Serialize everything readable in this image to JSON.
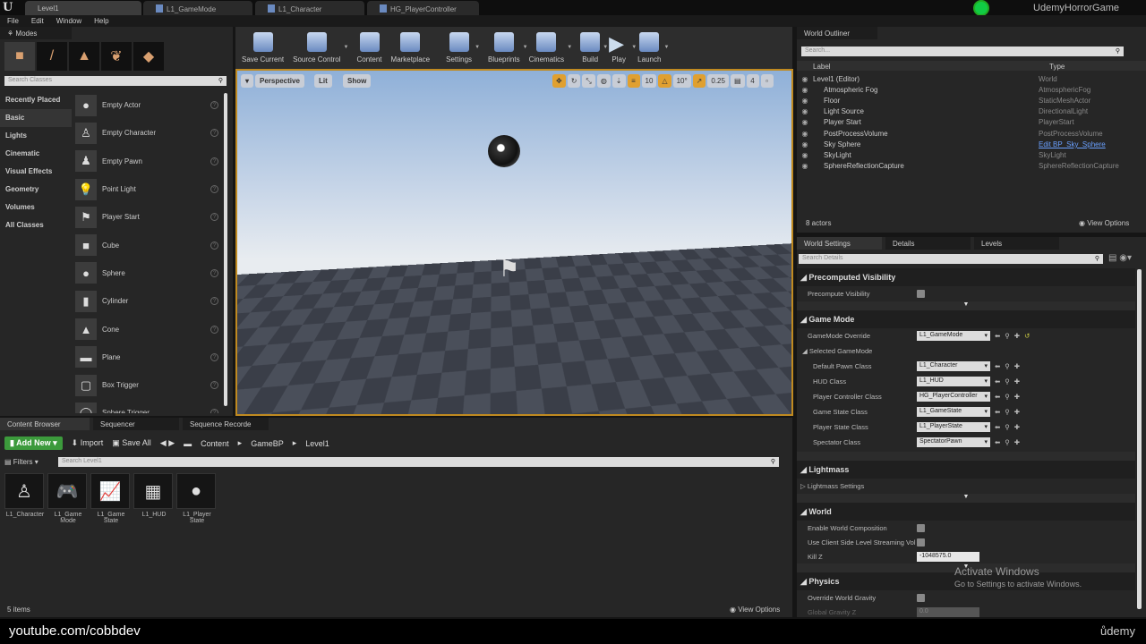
{
  "titlebar": {
    "tabs": [
      "Level1",
      "L1_GameMode",
      "L1_Character",
      "HG_PlayerController"
    ],
    "project": "UdemyHorrorGame"
  },
  "menu": [
    "File",
    "Edit",
    "Window",
    "Help"
  ],
  "modes": {
    "tab": "Modes",
    "search_placeholder": "Search Classes",
    "categories": [
      "Recently Placed",
      "Basic",
      "Lights",
      "Cinematic",
      "Visual Effects",
      "Geometry",
      "Volumes",
      "All Classes"
    ],
    "selected": 1,
    "items": [
      "Empty Actor",
      "Empty Character",
      "Empty Pawn",
      "Point Light",
      "Player Start",
      "Cube",
      "Sphere",
      "Cylinder",
      "Cone",
      "Plane",
      "Box Trigger",
      "Sphere Trigger"
    ]
  },
  "toolbar": [
    "Save Current",
    "Source Control",
    "Content",
    "Marketplace",
    "Settings",
    "Blueprints",
    "Cinematics",
    "Build",
    "Play",
    "Launch"
  ],
  "viewport": {
    "perspective": "Perspective",
    "lit": "Lit",
    "show": "Show",
    "grid": "10",
    "rotation": "10°",
    "scale": "0.25",
    "speed": "4"
  },
  "outliner": {
    "tab": "World Outliner",
    "search_placeholder": "Search...",
    "col_label": "Label",
    "col_type": "Type",
    "rows": [
      [
        "Level1 (Editor)",
        "World"
      ],
      [
        "Atmospheric Fog",
        "AtmosphericFog"
      ],
      [
        "Floor",
        "StaticMeshActor"
      ],
      [
        "Light Source",
        "DirectionalLight"
      ],
      [
        "Player Start",
        "PlayerStart"
      ],
      [
        "PostProcessVolume",
        "PostProcessVolume"
      ],
      [
        "Sky Sphere",
        "Edit BP_Sky_Sphere"
      ],
      [
        "SkyLight",
        "SkyLight"
      ],
      [
        "SphereReflectionCapture",
        "SphereReflectionCapture"
      ]
    ],
    "count": "8 actors",
    "view_options": "View Options"
  },
  "details": {
    "tabs": [
      "World Settings",
      "Details",
      "Levels"
    ],
    "search_placeholder": "Search Details",
    "precomputed": {
      "title": "Precomputed Visibility",
      "prop": "Precompute Visibility"
    },
    "gamemode": {
      "title": "Game Mode",
      "override_label": "GameMode Override",
      "override": "L1_GameMode",
      "selected": "Selected GameMode",
      "props": [
        [
          "Default Pawn Class",
          "L1_Character"
        ],
        [
          "HUD Class",
          "L1_HUD"
        ],
        [
          "Player Controller Class",
          "HG_PlayerController"
        ],
        [
          "Game State Class",
          "L1_GameState"
        ],
        [
          "Player State Class",
          "L1_PlayerState"
        ],
        [
          "Spectator Class",
          "SpectatorPawn"
        ]
      ]
    },
    "lightmass": {
      "title": "Lightmass",
      "prop": "Lightmass Settings"
    },
    "world": {
      "title": "World",
      "p1": "Enable World Composition",
      "p2": "Use Client Side Level Streaming Vol",
      "p3": "Kill Z",
      "killz": "-1048575.0"
    },
    "physics": {
      "title": "Physics",
      "p1": "Override World Gravity",
      "p2": "Global Gravity Z",
      "gravity": "0.0"
    }
  },
  "watermark": {
    "title": "Activate Windows",
    "sub": "Go to Settings to activate Windows."
  },
  "content": {
    "tabs": [
      "Content Browser",
      "Sequencer",
      "Sequence Recorde"
    ],
    "add_new": "Add New",
    "import": "Import",
    "save_all": "Save All",
    "path": [
      "Content",
      "GameBP",
      "Level1"
    ],
    "filters": "Filters",
    "search_placeholder": "Search Level1",
    "assets": [
      "L1_Character",
      "L1_Game Mode",
      "L1_Game State",
      "L1_HUD",
      "L1_Player State"
    ],
    "count": "5 items",
    "view_options": "View Options"
  },
  "footer": {
    "channel": "youtube.com/cobbdev",
    "brand": "ůdemy"
  }
}
